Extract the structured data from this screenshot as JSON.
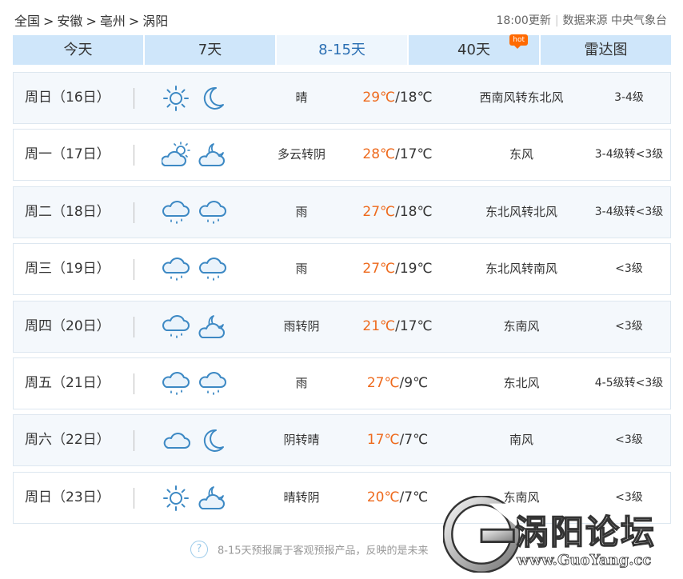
{
  "breadcrumb": [
    "全国",
    "安徽",
    "亳州",
    "涡阳"
  ],
  "breadcrumb_sep": ">",
  "meta": {
    "update_time": "18:00更新",
    "source": "数据来源 中央气象台"
  },
  "tabs": [
    {
      "label": "今天",
      "active": false
    },
    {
      "label": "7天",
      "active": false
    },
    {
      "label": "8-15天",
      "active": true
    },
    {
      "label": "40天",
      "active": false,
      "badge": "hot"
    },
    {
      "label": "雷达图",
      "active": false
    }
  ],
  "forecast": [
    {
      "day": "周日（16日）",
      "icons": [
        "sun-icon",
        "moon-icon"
      ],
      "desc": "晴",
      "high": "29℃",
      "low": "/18℃",
      "wind": "西南风转东北风",
      "level": "3-4级"
    },
    {
      "day": "周一（17日）",
      "icons": [
        "sun-cloud-icon",
        "moon-cloud-icon"
      ],
      "desc": "多云转阴",
      "high": "28℃",
      "low": "/17℃",
      "wind": "东风",
      "level": "3-4级转<3级"
    },
    {
      "day": "周二（18日）",
      "icons": [
        "rain-icon",
        "rain-icon"
      ],
      "desc": "雨",
      "high": "27℃",
      "low": "/18℃",
      "wind": "东北风转北风",
      "level": "3-4级转<3级"
    },
    {
      "day": "周三（19日）",
      "icons": [
        "rain-icon",
        "rain-icon"
      ],
      "desc": "雨",
      "high": "27℃",
      "low": "/19℃",
      "wind": "东北风转南风",
      "level": "<3级"
    },
    {
      "day": "周四（20日）",
      "icons": [
        "rain-icon",
        "moon-cloud-icon"
      ],
      "desc": "雨转阴",
      "high": "21℃",
      "low": "/17℃",
      "wind": "东南风",
      "level": "<3级"
    },
    {
      "day": "周五（21日）",
      "icons": [
        "rain-icon",
        "rain-icon"
      ],
      "desc": "雨",
      "high": "27℃",
      "low": "/9℃",
      "wind": "东北风",
      "level": "4-5级转<3级"
    },
    {
      "day": "周六（22日）",
      "icons": [
        "cloud-icon",
        "moon-icon"
      ],
      "desc": "阴转晴",
      "high": "17℃",
      "low": "/7℃",
      "wind": "南风",
      "level": "<3级"
    },
    {
      "day": "周日（23日）",
      "icons": [
        "sun-icon",
        "moon-cloud-icon"
      ],
      "desc": "晴转阴",
      "high": "20℃",
      "low": "/7℃",
      "wind": "东南风",
      "level": "<3级"
    }
  ],
  "note": {
    "icon": "?",
    "text": "8-15天预报属于客观预报产品，反映的是未来"
  },
  "watermark": {
    "title": "涡阳论坛",
    "url": "www.GuoYang.cc"
  },
  "colors": {
    "accent": "#2b6fb3",
    "tab_bg": "#cfe6fa",
    "tab_active_bg": "#eef6fd",
    "high_temp": "#ee6a1d",
    "icon_blue": "#3d89c4"
  }
}
